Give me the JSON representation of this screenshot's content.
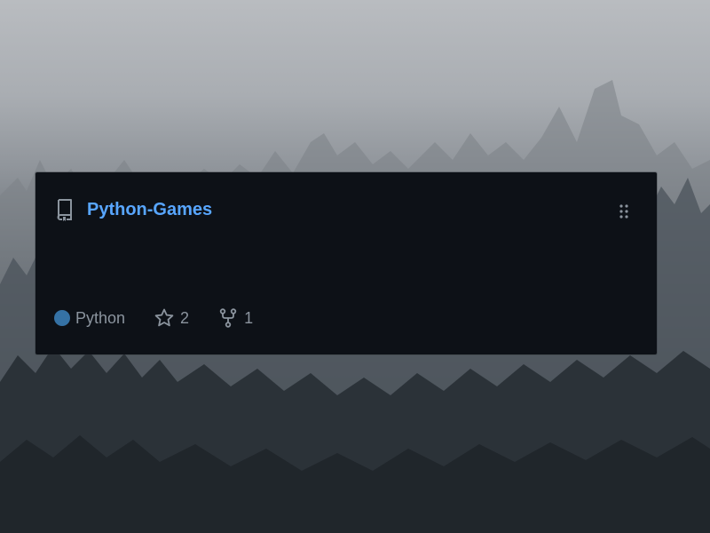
{
  "repo": {
    "name": "Python-Games",
    "description": "",
    "language": "Python",
    "stars": "2",
    "forks": "1"
  },
  "icons": {
    "repo": "repo-book-icon",
    "drag": "grabber-icon",
    "star": "star-icon",
    "fork": "fork-icon"
  },
  "colors": {
    "card_background": "#0d1117",
    "repo_link": "#58a6ff",
    "muted_text": "#8b949e",
    "language_python": "#3572A5"
  }
}
